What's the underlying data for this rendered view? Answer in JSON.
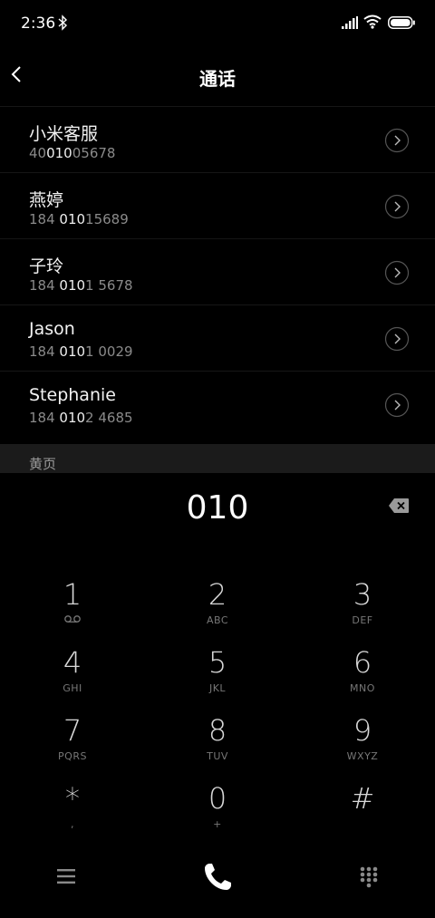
{
  "status_bar": {
    "time": "2:36",
    "icons": [
      "bluetooth-icon",
      "signal-icon",
      "wifi-icon",
      "battery-icon"
    ]
  },
  "header": {
    "title": "通话",
    "back_icon": "chevron-left-icon"
  },
  "contacts": [
    {
      "name": "小米客服",
      "number_parts": [
        "40",
        "010",
        "05678"
      ]
    },
    {
      "name": "燕婷",
      "number_parts": [
        "184 ",
        "010",
        "15689"
      ]
    },
    {
      "name": "子玲",
      "number_parts": [
        "184 ",
        "010",
        "1 5678"
      ]
    },
    {
      "name": "Jason",
      "number_parts": [
        "184 ",
        "010",
        "1 0029"
      ]
    },
    {
      "name": "Stephanie",
      "number_parts": [
        "184 ",
        "010",
        "2 4685"
      ]
    }
  ],
  "section": {
    "label": "黄页"
  },
  "dial_input": {
    "value": "010",
    "backspace_icon": "backspace-icon"
  },
  "keypad": [
    {
      "digit": "1",
      "letters": "",
      "icon": "voicemail-icon"
    },
    {
      "digit": "2",
      "letters": "ABC"
    },
    {
      "digit": "3",
      "letters": "DEF"
    },
    {
      "digit": "4",
      "letters": "GHI"
    },
    {
      "digit": "5",
      "letters": "JKL"
    },
    {
      "digit": "6",
      "letters": "MNO"
    },
    {
      "digit": "7",
      "letters": "PQRS"
    },
    {
      "digit": "8",
      "letters": "TUV"
    },
    {
      "digit": "9",
      "letters": "WXYZ"
    },
    {
      "digit": "*",
      "letters": ","
    },
    {
      "digit": "0",
      "letters": "+"
    },
    {
      "digit": "#",
      "letters": ""
    }
  ],
  "bottom_bar": {
    "icons": [
      "menu-icon",
      "phone-icon",
      "dialpad-icon"
    ]
  },
  "colors": {
    "background": "#000000",
    "section_background": "#1b1b1b",
    "secondary_text": "#8a8a8a"
  }
}
